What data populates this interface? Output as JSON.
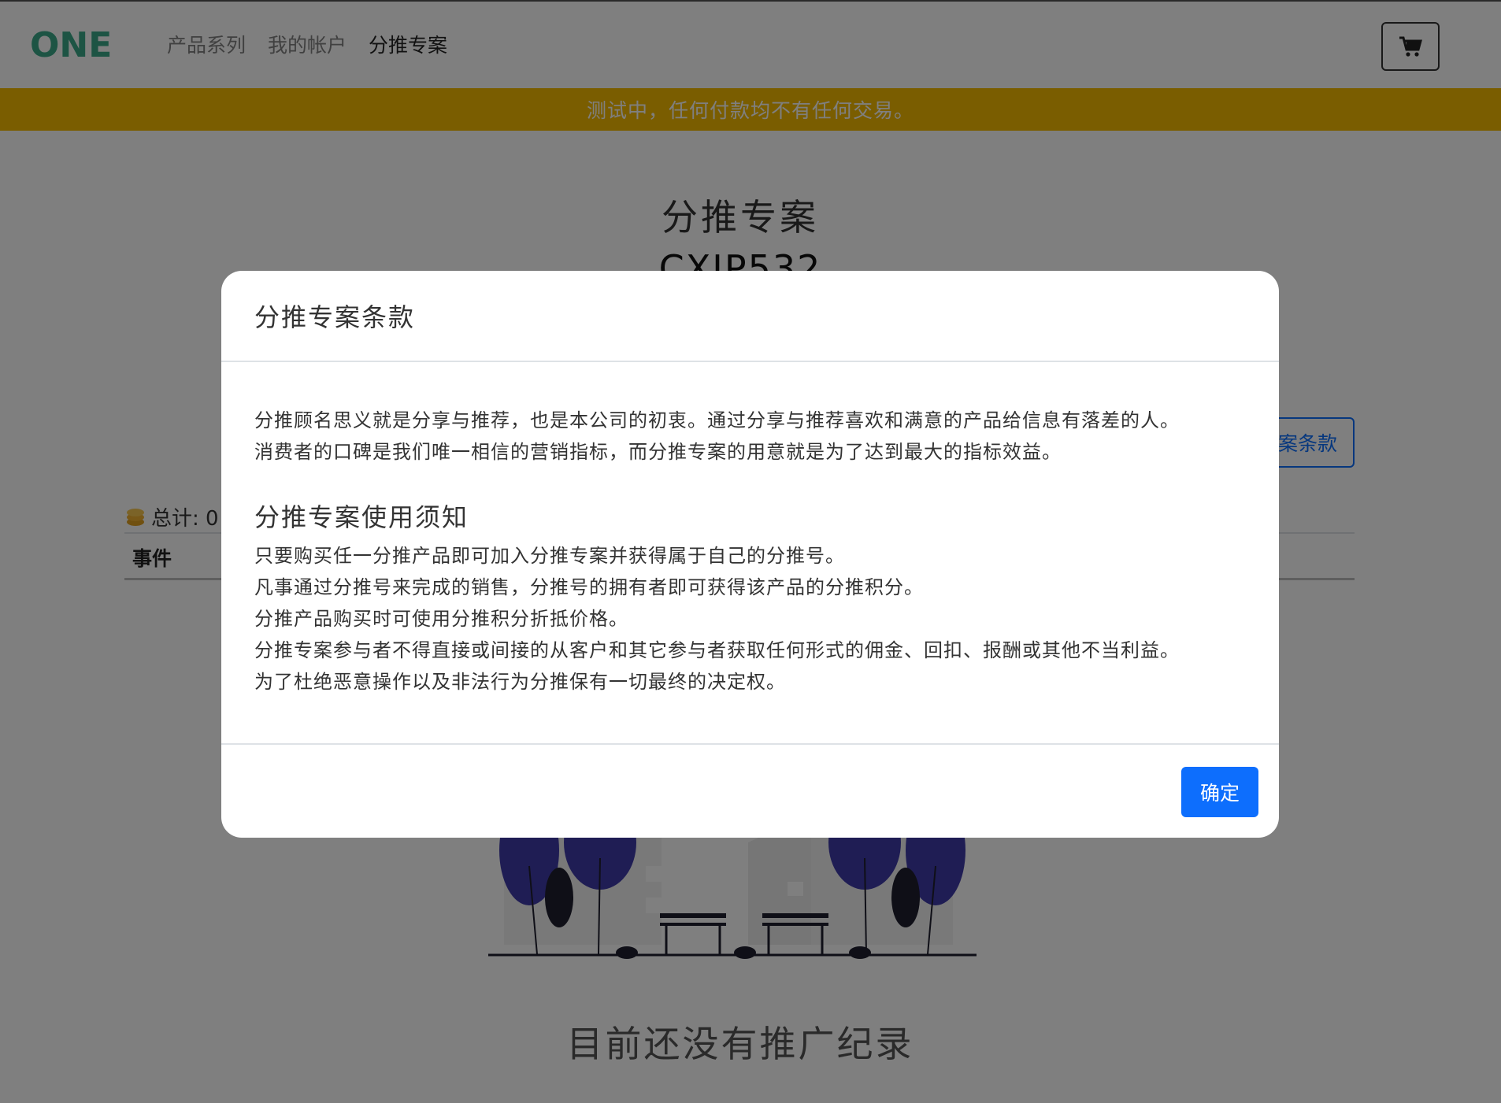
{
  "nav": {
    "logo_text": "ONE",
    "links": [
      "产品系列",
      "我的帐户",
      "分推专案"
    ],
    "cart_icon": "shopping-cart-icon"
  },
  "banner": {
    "text": "测试中，任何付款均不有任何交易。"
  },
  "page": {
    "title": "分推专案",
    "code": "CXIP532",
    "terms_button_label": "案条款",
    "total_label": "总计: 0",
    "table_header_event": "事件",
    "empty_message": "目前还没有推广纪录"
  },
  "modal": {
    "title": "分推专案条款",
    "intro": [
      "分推顾名思义就是分享与推荐，也是本公司的初衷。通过分享与推荐喜欢和满意的产品给信息有落差的人。",
      "消费者的口碑是我们唯一相信的营销指标，而分推专案的用意就是为了达到最大的指标效益。"
    ],
    "notice_heading": "分推专案使用须知",
    "rules": [
      "只要购买任一分推产品即可加入分推专案并获得属于自己的分推号。",
      "凡事通过分推号来完成的销售，分推号的拥有者即可获得该产品的分推积分。",
      "分推产品购买时可使用分推积分折抵价格。",
      "分推专案参与者不得直接或间接的从客户和其它参与者获取任何形式的佣金、回扣、报酬或其他不当利益。",
      "为了杜绝恶意操作以及非法行为分推保有一切最终的决定权。"
    ],
    "confirm_label": "确定"
  },
  "colors": {
    "brand_green": "#3aa889",
    "banner_yellow": "#f4bb00",
    "primary_blue": "#0d6efd",
    "tree_purple": "#3f3aa8"
  }
}
